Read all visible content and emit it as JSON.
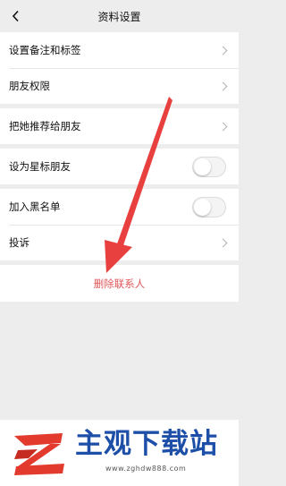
{
  "nav": {
    "title": "资料设置"
  },
  "groups": [
    {
      "items": [
        {
          "label": "设置备注和标签"
        },
        {
          "label": "朋友权限"
        }
      ]
    },
    {
      "items": [
        {
          "label": "把她推荐给朋友"
        }
      ]
    },
    {
      "items": [
        {
          "label": "设为星标朋友",
          "toggle_on": false
        }
      ]
    },
    {
      "items": [
        {
          "label": "加入黑名单",
          "toggle_on": false
        },
        {
          "label": "投诉"
        }
      ]
    }
  ],
  "actions": {
    "delete_label": "删除联系人"
  },
  "colors": {
    "accent_red": "#e05658",
    "arrow_red": "#e8403f",
    "logo_blue": "#1d4fa8"
  },
  "watermark": {
    "name": "主观下载站",
    "url": "www.zghdw888.com"
  }
}
